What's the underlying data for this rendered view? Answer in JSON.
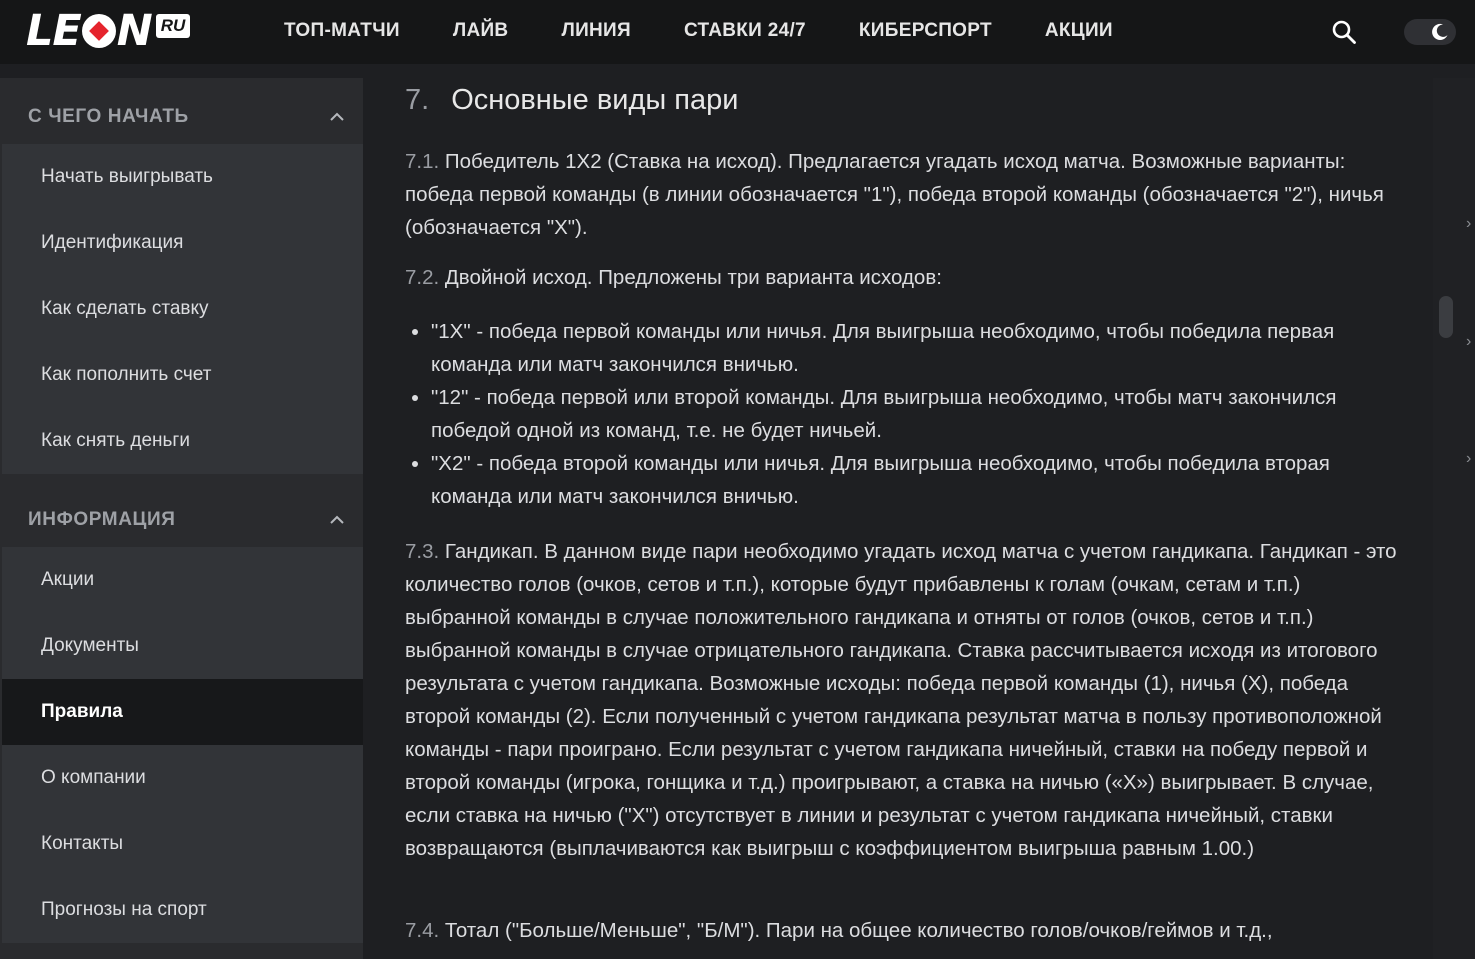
{
  "header": {
    "logo_text_left": "LE",
    "logo_text_right": "N",
    "logo_badge": "RU",
    "nav": [
      "ТОП-МАТЧИ",
      "ЛАЙВ",
      "ЛИНИЯ",
      "СТАВКИ 24/7",
      "КИБЕРСПОРТ",
      "АКЦИИ"
    ],
    "search_icon": "search-icon",
    "theme_icon": "moon-icon"
  },
  "sidebar": {
    "section1_title": "С ЧЕГО НАЧАТЬ",
    "section1_items": [
      "Начать выигрывать",
      "Идентификация",
      "Как сделать ставку",
      "Как пополнить счет",
      "Как снять деньги"
    ],
    "section2_title": "ИНФОРМАЦИЯ",
    "section2_items": [
      "Акции",
      "Документы",
      "Правила",
      "О компании",
      "Контакты",
      "Прогнозы на спорт"
    ],
    "active_item": "Правила"
  },
  "content": {
    "heading_num": "7.",
    "heading": "Основные виды пари",
    "p71_num": "7.1.",
    "p71": "Победитель 1Х2 (Ставка на исход). Предлагается угадать исход матча. Возможные варианты: победа первой команды (в линии обозначается \"1\"), победа второй команды (обозначается \"2\"), ничья (обозначается \"Х\").",
    "p72_num": "7.2.",
    "p72": "Двойной исход. Предложены три варианта исходов:",
    "bullets": [
      "\"1Х\" - победа первой команды или ничья. Для выигрыша необходимо, чтобы победила первая команда или матч закончился вничью.",
      "\"12\" - победа первой или второй команды. Для выигрыша необходимо, чтобы матч закончился победой одной из команд, т.е. не будет ничьей.",
      "\"Х2\" - победа второй команды или ничья. Для выигрыша необходимо, чтобы победила вторая команда или матч закончился вничью."
    ],
    "p73_num": "7.3.",
    "p73": "Гандикап. В данном виде пари необходимо угадать исход матча с учетом гандикапа. Гандикап - это количество голов (очков, сетов и т.п.), которые будут прибавлены к голам (очкам, сетам и т.п.) выбранной команды в случае положительного гандикапа и отняты от голов (очков, сетов и т.п.) выбранной команды в случае отрицательного гандикапа. Ставка рассчитывается исходя из итогового результата с учетом гандикапа. Возможные исходы: победа первой команды (1), ничья (Х), победа второй команды (2). Если полученный с учетом гандикапа результат матча в пользу противоположной команды - пари проиграно. Если результат с учетом гандикапа ничейный, ставки на победу первой и второй команды (игрока, гонщика и т.д.) проигрывают, а ставка на ничью («Х») выигрывает. В случае, если ставка на ничью (\"Х\") отсутствует в линии и результат с учетом гандикапа ничейный, ставки возвращаются (выплачиваются как выигрыш с коэффициентом выигрыша равным 1.00.)",
    "p74_num": "7.4.",
    "p74": "Тотал (\"Больше/Меньше\", \"Б/М\"). Пари на общее количество голов/очков/геймов и т.д.,"
  },
  "colors": {
    "topbar_bg": "#151617",
    "sidebar_bg": "#2a2b2e",
    "item_bg": "#323438",
    "active_bg": "#17181a",
    "content_bg": "#1e1f22",
    "logo_red": "#e5242d"
  }
}
